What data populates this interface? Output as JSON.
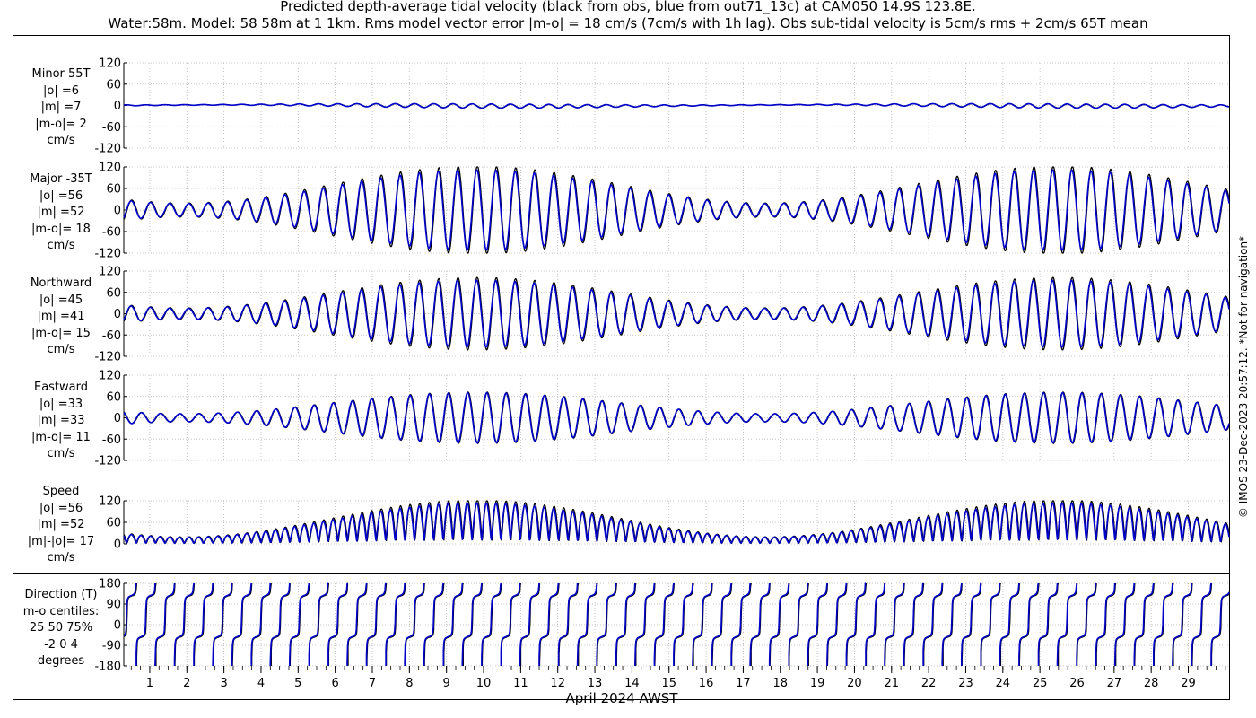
{
  "title_line1": "Predicted depth-average tidal velocity (black from obs, blue from out71_13c) at CAM050 14.9S 123.8E.",
  "title_line2": "Water:58m. Model: 58 58m at 1 1km. Rms model vector error |m-o| = 18 cm/s (7cm/s with 1h lag). Obs sub-tidal velocity is 5cm/s rms + 2cm/s 65T mean",
  "credit": "© IMOS 23-Dec-2023 20:57:12. *Not for navigation*",
  "chart_data": {
    "type": "line",
    "xlabel": "April 2024 AWST",
    "x_ticks": [
      "1",
      "2",
      "3",
      "4",
      "5",
      "6",
      "7",
      "8",
      "9",
      "10",
      "11",
      "12",
      "13",
      "14",
      "15",
      "16",
      "17",
      "18",
      "19",
      "20",
      "21",
      "22",
      "23",
      "24",
      "25",
      "26",
      "27",
      "28",
      "29"
    ],
    "x_range_days": [
      0.3,
      30.1
    ],
    "grid": true,
    "series_colors": {
      "obs": "#000000",
      "model": "#0000cc"
    },
    "tidal_model": {
      "semidiurnal_period_h": 12.42,
      "spring_days": [
        9.8,
        25.5
      ],
      "neap_days": [
        3.5,
        17.3
      ],
      "m2_amplitude_fraction": 0.58,
      "s2_amplitude_fraction": 0.42
    },
    "panels": [
      {
        "id": "minor",
        "label_lines": [
          "Minor 55T",
          "|o| =6",
          "|m| =7",
          "|m-o|= 2",
          "cm/s"
        ],
        "ylim": [
          -120,
          120
        ],
        "yticks": [
          -120,
          -60,
          0,
          60,
          120
        ],
        "obs_peak": 10,
        "model_peak": 11,
        "phase_h": 2
      },
      {
        "id": "major",
        "label_lines": [
          "Major -35T",
          "|o| =56",
          "|m| =52",
          "|m-o|= 18",
          "cm/s"
        ],
        "ylim": [
          -120,
          120
        ],
        "yticks": [
          -120,
          -60,
          0,
          60,
          120
        ],
        "obs_peak": 122,
        "model_peak": 112,
        "phase_h": 0
      },
      {
        "id": "north",
        "label_lines": [
          "Northward",
          "|o| =45",
          "|m| =41",
          "|m-o|= 15",
          "cm/s"
        ],
        "ylim": [
          -120,
          120
        ],
        "yticks": [
          -120,
          -60,
          0,
          60,
          120
        ],
        "obs_peak": 102,
        "model_peak": 94,
        "phase_h": 0
      },
      {
        "id": "east",
        "label_lines": [
          "Eastward",
          "|o| =33",
          "|m| =33",
          "|m-o|= 11",
          "cm/s"
        ],
        "ylim": [
          -120,
          120
        ],
        "yticks": [
          -120,
          -60,
          0,
          60,
          120
        ],
        "obs_peak": 72,
        "model_peak": 70,
        "phase_h": 0
      },
      {
        "id": "speed",
        "label_lines": [
          "Speed",
          "|o| =56",
          "|m| =52",
          "|m|-|o|= 17",
          "cm/s"
        ],
        "ylim": [
          0,
          120
        ],
        "yticks": [
          0,
          60,
          120
        ],
        "obs_peak": 122,
        "model_peak": 114,
        "phase_h": 0
      },
      {
        "id": "direction",
        "label_lines": [
          "Direction (T)",
          "m-o centiles:",
          "25  50  75%",
          "-2  0  4",
          "degrees"
        ],
        "ylim": [
          -180,
          180
        ],
        "yticks": [
          -180,
          -90,
          0,
          90,
          180
        ]
      }
    ]
  }
}
